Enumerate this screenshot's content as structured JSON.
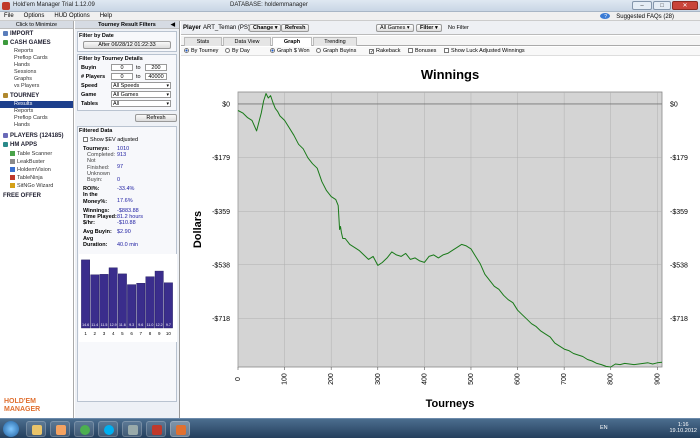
{
  "window": {
    "title": "Hold'em Manager Trial 1.12.09",
    "database": "DATABASE: holdemmanager",
    "controls": [
      "–",
      "□",
      "✕"
    ]
  },
  "menu": {
    "items": [
      "File",
      "Options",
      "HUD Options",
      "Help"
    ],
    "faq": "Suggested FAQs (28)"
  },
  "left_nav": {
    "header": "Click to Minimize",
    "import": "IMPORT",
    "cash_games": "CASH GAMES",
    "cash_items": [
      "Reports",
      "Preflop Cards",
      "Hands",
      "Sessions",
      "Graphs",
      "vs Players"
    ],
    "tourney": "TOURNEY",
    "tourney_items": [
      "Results",
      "Reports",
      "Preflop Cards",
      "Hands"
    ],
    "players": "PLAYERS (124185)",
    "hm_apps": "HM APPS",
    "apps": [
      "Table Scanner",
      "LeakBuster",
      "HoldemVision",
      "TableNinja",
      "SitNGo Wizard"
    ],
    "free_offer": "FREE OFFER",
    "logo_line1": "HOLD'EM",
    "logo_line2": "MANAGER"
  },
  "filters": {
    "header": "Tourney Result Filters",
    "filter_by_date": "Filter by Date",
    "date_button": "After 06/28/12 01:22:33",
    "filter_by_details": "Filter by Tourney Details",
    "buyin_label": "Buyin",
    "buyin_from": "0",
    "buyin_to": "200",
    "players_label": "# Players",
    "players_from": "0",
    "players_to": "40000",
    "to_word": "to",
    "speed_label": "Speed",
    "speed_value": "All Speeds",
    "game_label": "Game",
    "game_value": "All Games",
    "tables_label": "Tables",
    "tables_value": "All",
    "refresh": "Refresh",
    "filtered_data": "Filtered Data",
    "show_ev": "Show $EV adjusted",
    "stats": [
      {
        "k": "Tourneys:",
        "v": "1010",
        "indent": false
      },
      {
        "k": "Completed:",
        "v": "913",
        "indent": true
      },
      {
        "k": "Not Finished:",
        "v": "97",
        "indent": true
      },
      {
        "k": "Unknown Buyin:",
        "v": "0",
        "indent": true
      },
      {
        "k": "",
        "v": "",
        "indent": false
      },
      {
        "k": "ROI%:",
        "v": "-33.4%",
        "indent": false
      },
      {
        "k": "In the Money%:",
        "v": "17.6%",
        "indent": false
      },
      {
        "k": "",
        "v": "",
        "indent": false
      },
      {
        "k": "Winnings:",
        "v": "-$883.88",
        "indent": false
      },
      {
        "k": "Time Played:",
        "v": "81.2 hours",
        "indent": false
      },
      {
        "k": "$/hr:",
        "v": "-$10.88",
        "indent": false
      },
      {
        "k": "",
        "v": "",
        "indent": false
      },
      {
        "k": "Avg Buyin:",
        "v": "$2.90",
        "indent": false
      },
      {
        "k": "Avg Duration:",
        "v": "40.0 min",
        "indent": false
      }
    ],
    "histogram": {
      "values": [
        14.6,
        11.4,
        11.5,
        12.9,
        11.6,
        9.3,
        9.6,
        11.0,
        12.2,
        9.7
      ],
      "value_labels": [
        "14.6",
        "11.4",
        "11.5",
        "12.9",
        "11.6",
        "9.3",
        "9.6",
        "11.0",
        "12.2",
        "9.7"
      ],
      "categories": [
        "1",
        "2",
        "3",
        "4",
        "5",
        "6",
        "7",
        "8",
        "9",
        "10"
      ],
      "max": 15
    }
  },
  "player_bar": {
    "player_label": "Player",
    "player_name": "ART_Teman (PS)",
    "change": "Change",
    "refresh": "Refresh",
    "games": "All Games",
    "filter": "Filter",
    "no_filter": "No Filter"
  },
  "tabs": [
    "Stats",
    "Data View",
    "Graph",
    "Trending"
  ],
  "active_tab": "Graph",
  "graph_options": {
    "by_tourney": "By Tourney",
    "by_day": "By Day",
    "graph_won": "Graph $ Won",
    "graph_buyins": "Graph Buyins",
    "rakeback": "Rakeback",
    "bonuses": "Bonuses",
    "show_luck": "Show Luck Adjusted Winnings"
  },
  "chart_data": {
    "type": "line",
    "title": "Winnings",
    "xlabel": "Tourneys",
    "ylabel": "Dollars",
    "xlim": [
      0,
      910
    ],
    "ylim": [
      -880,
      40
    ],
    "x_ticks": [
      "0",
      "100",
      "200",
      "300",
      "400",
      "500",
      "600",
      "700",
      "800",
      "900"
    ],
    "x_tick_values": [
      0,
      100,
      200,
      300,
      400,
      500,
      600,
      700,
      800,
      900
    ],
    "y_ticks": [
      "$0",
      "-$179",
      "-$359",
      "-$538",
      "-$718"
    ],
    "y_tick_values": [
      0,
      -179,
      -359,
      -538,
      -718
    ],
    "grid": true,
    "line_color": "#1a7a1a",
    "series": [
      {
        "x": [
          0,
          10,
          20,
          30,
          40,
          50,
          55,
          60,
          65,
          70,
          75,
          80,
          85,
          90,
          100,
          110,
          120,
          130,
          140,
          150,
          160,
          170,
          180,
          190,
          200,
          210,
          215,
          218,
          220,
          222,
          225,
          230,
          240,
          250,
          260,
          270,
          280,
          290,
          300,
          310,
          320,
          330,
          340,
          350,
          360,
          370,
          380,
          390,
          400,
          410,
          420,
          430,
          440,
          450,
          460,
          470,
          480,
          490,
          500,
          510,
          520,
          530,
          540,
          550,
          560,
          570,
          580,
          590,
          600,
          610,
          620,
          630,
          640,
          650,
          660,
          670,
          680,
          690,
          700,
          710,
          720,
          730,
          740,
          750,
          760,
          770,
          780,
          790,
          800,
          810,
          820,
          830,
          840,
          850,
          860,
          870,
          880,
          890,
          900,
          910
        ],
        "y": [
          -22,
          -30,
          -45,
          -55,
          -90,
          -30,
          10,
          35,
          20,
          28,
          5,
          -15,
          -25,
          -40,
          -55,
          -80,
          -105,
          -135,
          -150,
          -180,
          -200,
          -215,
          -260,
          -290,
          -310,
          -320,
          -340,
          -420,
          -410,
          -430,
          -450,
          -450,
          -470,
          -480,
          -490,
          -505,
          -520,
          -510,
          -540,
          -530,
          -515,
          -495,
          -505,
          -510,
          -500,
          -520,
          -515,
          -525,
          -530,
          -510,
          -505,
          -515,
          -505,
          -500,
          -490,
          -480,
          -470,
          -475,
          -485,
          -510,
          -535,
          -570,
          -590,
          -610,
          -620,
          -640,
          -655,
          -665,
          -690,
          -705,
          -720,
          -735,
          -745,
          -760,
          -770,
          -780,
          -800,
          -810,
          -820,
          -825,
          -835,
          -840,
          -845,
          -855,
          -860,
          -868,
          -872,
          -878,
          -880,
          -870,
          -872,
          -868,
          -870,
          -872,
          -870,
          -868,
          -866,
          -870,
          -866,
          -864
        ]
      }
    ]
  },
  "taskbar": {
    "lang": "EN",
    "time": "1:16",
    "date": "19.10.2012"
  }
}
